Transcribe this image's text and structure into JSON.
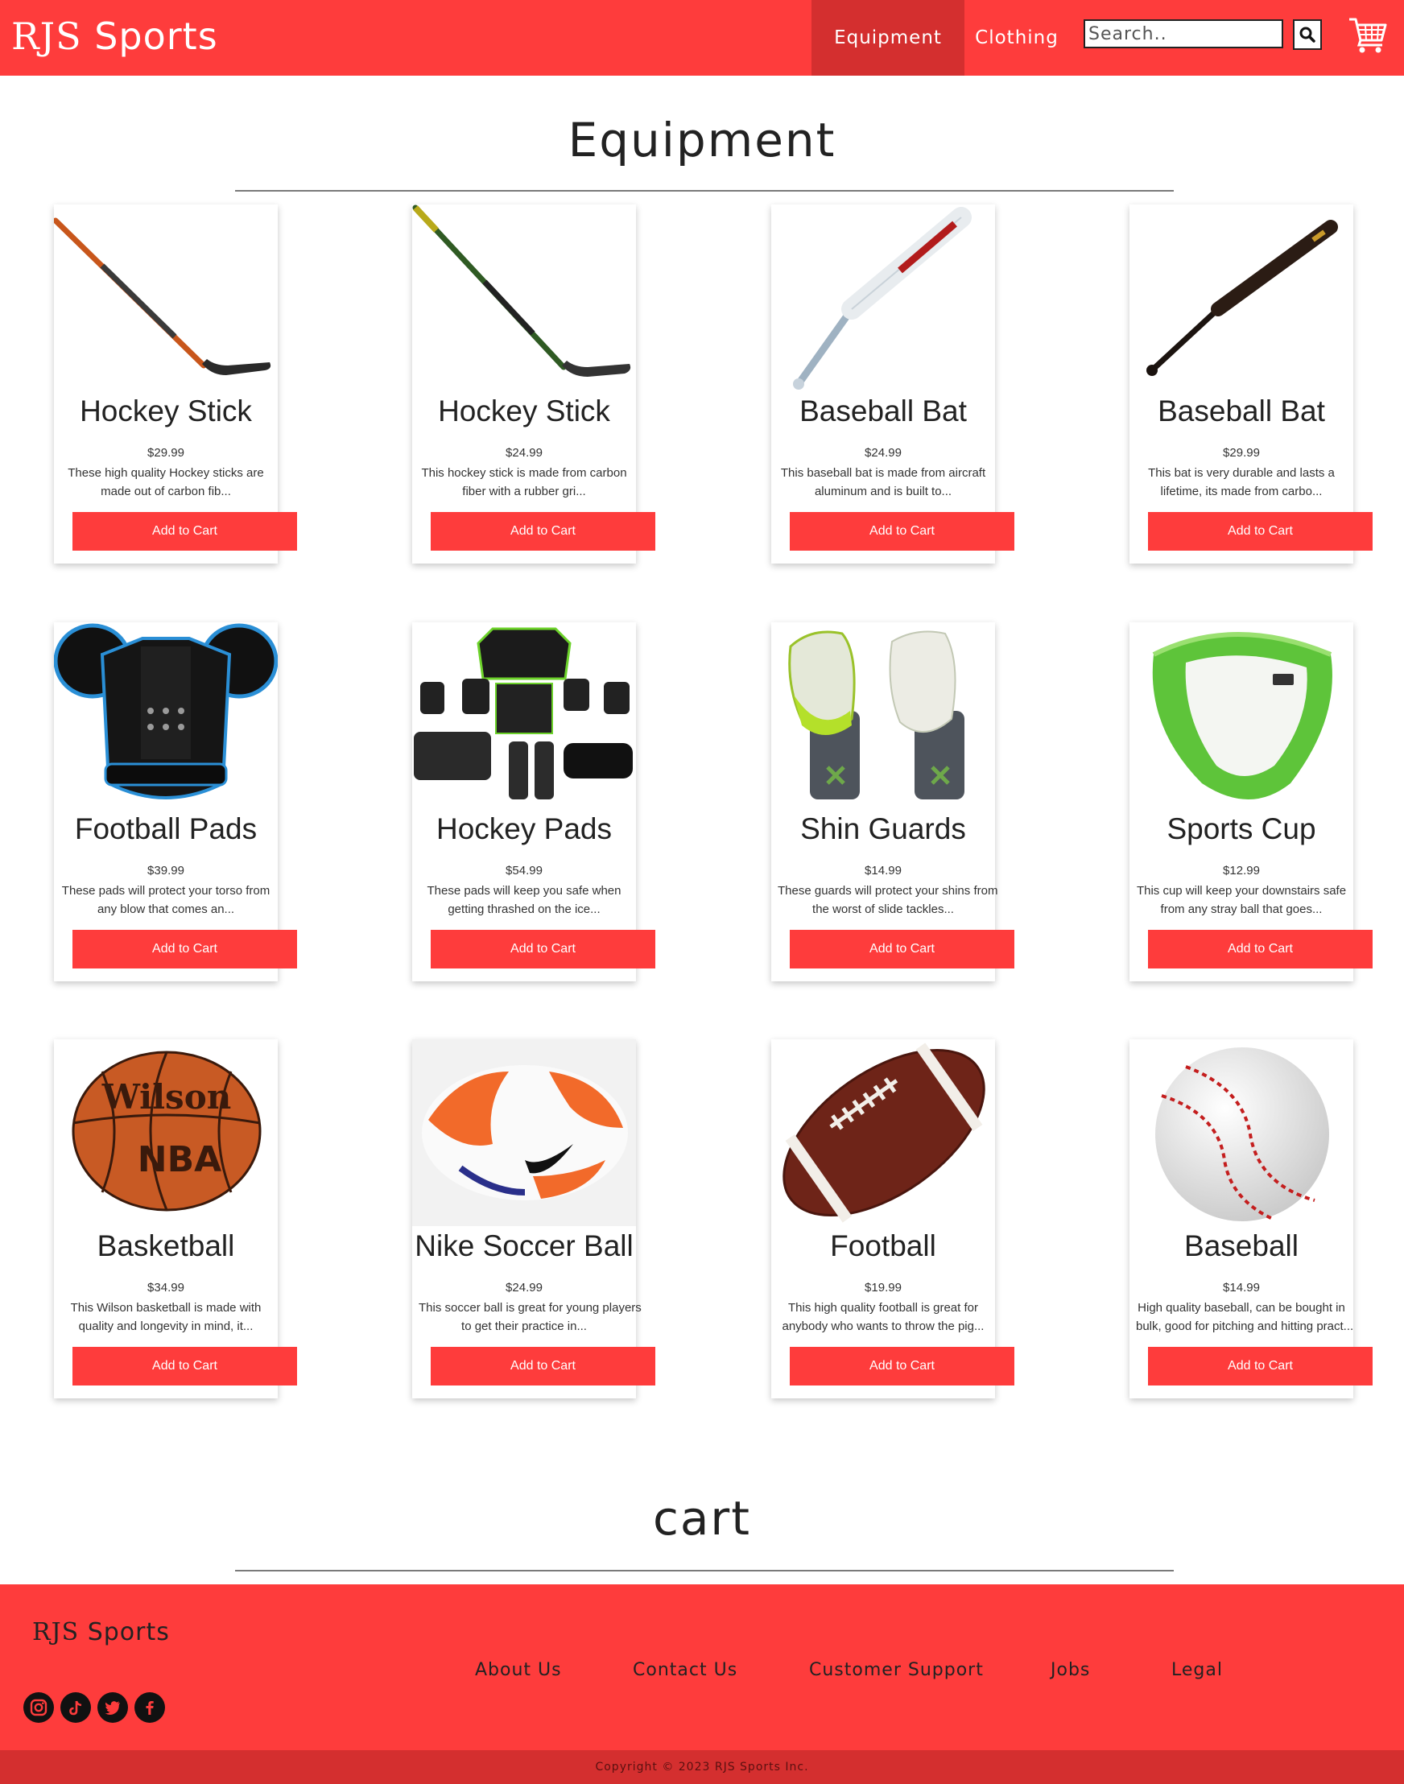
{
  "header": {
    "logo": "RJS Sports",
    "tabs": [
      {
        "label": "Equipment",
        "active": true
      },
      {
        "label": "Clothing",
        "active": false
      }
    ],
    "search_placeholder": "Search.."
  },
  "sections": {
    "equipment_title": "Equipment",
    "cart_title": "cart"
  },
  "products": [
    {
      "name": "Hockey Stick",
      "price": "$29.99",
      "desc1": "These high quality Hockey sticks are",
      "desc2": "made out of carbon fib...",
      "button": "Add to Cart",
      "image": "hockey-stick-orange"
    },
    {
      "name": "Hockey Stick",
      "price": "$24.99",
      "desc1": "This hockey stick is made from carbon",
      "desc2": "fiber with a rubber gri...",
      "button": "Add to Cart",
      "image": "hockey-stick-green"
    },
    {
      "name": "Baseball Bat",
      "price": "$24.99",
      "desc1": "This baseball bat is made from aircraft",
      "desc2": "aluminum and is built to...",
      "button": "Add to Cart",
      "image": "baseball-bat-aluminum"
    },
    {
      "name": "Baseball Bat",
      "price": "$29.99",
      "desc1": "This bat is very durable and lasts a",
      "desc2": "lifetime, its made from carbo...",
      "button": "Add to Cart",
      "image": "baseball-bat-wood"
    },
    {
      "name": "Football Pads",
      "price": "$39.99",
      "desc1": "These pads will protect your torso from",
      "desc2": "any blow that comes an...",
      "button": "Add to Cart",
      "image": "football-pads"
    },
    {
      "name": "Hockey Pads",
      "price": "$54.99",
      "desc1": "These pads will keep you safe when",
      "desc2": "getting thrashed on the ice...",
      "button": "Add to Cart",
      "image": "hockey-pads"
    },
    {
      "name": "Shin Guards",
      "price": "$14.99",
      "desc1": "These guards will protect your shins from",
      "desc2": "the worst of slide tackles...",
      "button": "Add to Cart",
      "image": "shin-guards"
    },
    {
      "name": "Sports Cup",
      "price": "$12.99",
      "desc1": "This cup will keep your downstairs safe",
      "desc2": "from any stray ball that goes...",
      "button": "Add to Cart",
      "image": "sports-cup"
    },
    {
      "name": "Basketball",
      "price": "$34.99",
      "desc1": "This Wilson basketball is made with",
      "desc2": "quality and longevity in mind, it...",
      "button": "Add to Cart",
      "image": "basketball"
    },
    {
      "name": "Nike Soccer Ball",
      "price": "$24.99",
      "desc1": "This soccer ball is great for young players",
      "desc2": "to get their practice in...",
      "button": "Add to Cart",
      "image": "soccer-ball"
    },
    {
      "name": "Football",
      "price": "$19.99",
      "desc1": "This high quality football is great for",
      "desc2": "anybody who wants to throw the pig...",
      "button": "Add to Cart",
      "image": "football"
    },
    {
      "name": "Baseball",
      "price": "$14.99",
      "desc1": "High quality baseball, can be bought in",
      "desc2": "bulk, good for pitching and hitting pract...",
      "button": "Add to Cart",
      "image": "baseball"
    }
  ],
  "footer": {
    "brand": "RJS Sports",
    "links": [
      "About Us",
      "Contact Us",
      "Customer Support",
      "Jobs",
      "Legal"
    ],
    "social_icons": [
      "instagram-icon",
      "tiktok-icon",
      "twitter-icon",
      "facebook-icon"
    ],
    "copyright": "Copyright © 2023 RJS Sports Inc."
  },
  "colors": {
    "brand_red": "#fe3c3c",
    "active_tab": "#d42f2f",
    "copyright_bar": "#d42f2f"
  }
}
